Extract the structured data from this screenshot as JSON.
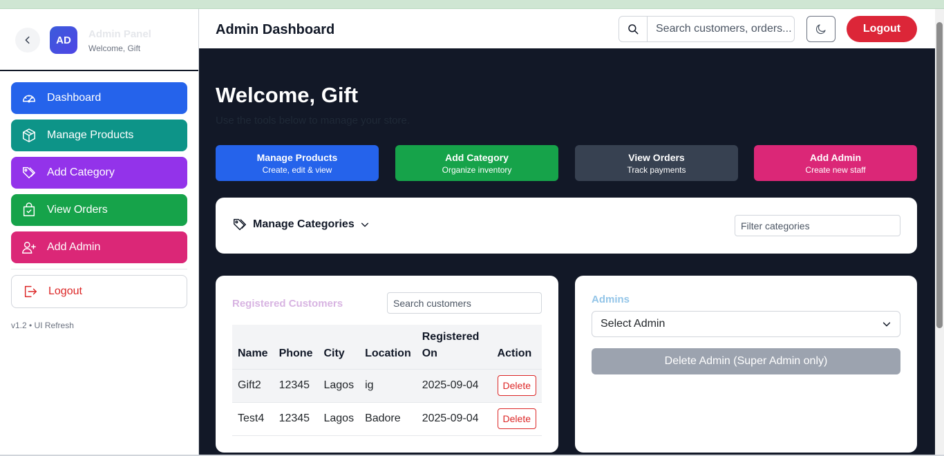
{
  "sidebar": {
    "avatar_initials": "AD",
    "panel_title": "Admin Panel",
    "panel_subtitle": "Welcome, Gift",
    "nav": [
      {
        "label": "Dashboard",
        "icon": "gauge-icon",
        "color": "#2563eb"
      },
      {
        "label": "Manage Products",
        "icon": "box-icon",
        "color": "#0d9488"
      },
      {
        "label": "Add Category",
        "icon": "tag-icon",
        "color": "#9333ea"
      },
      {
        "label": "View Orders",
        "icon": "bag-icon",
        "color": "#16a34a"
      },
      {
        "label": "Add Admin",
        "icon": "user-plus-icon",
        "color": "#db2777"
      }
    ],
    "logout_label": "Logout",
    "version": "v1.2 • UI Refresh"
  },
  "header": {
    "title": "Admin Dashboard",
    "search_placeholder": "Search customers, orders...",
    "logout_label": "Logout"
  },
  "main": {
    "welcome": "Welcome, Gift",
    "welcome_sub": "Use the tools below to manage your store.",
    "quick_actions": [
      {
        "title": "Manage Products",
        "subtitle": "Create, edit & view",
        "color": "#2563eb"
      },
      {
        "title": "Add Category",
        "subtitle": "Organize inventory",
        "color": "#16a34a"
      },
      {
        "title": "View Orders",
        "subtitle": "Track payments",
        "color": "#374151"
      },
      {
        "title": "Add Admin",
        "subtitle": "Create new staff",
        "color": "#db2777"
      }
    ],
    "categories": {
      "title": "Manage Categories",
      "filter_placeholder": "Filter categories"
    },
    "customers": {
      "title": "Registered Customers",
      "search_placeholder": "Search customers",
      "columns": [
        "Name",
        "Phone",
        "City",
        "Location",
        "Registered On",
        "Action"
      ],
      "rows": [
        {
          "name": "Gift2",
          "phone": "12345",
          "city": "Lagos",
          "location": "ig",
          "registered": "2025-09-04",
          "action": "Delete"
        },
        {
          "name": "Test4",
          "phone": "12345",
          "city": "Lagos",
          "location": "Badore",
          "registered": "2025-09-04",
          "action": "Delete"
        }
      ]
    },
    "admins": {
      "title": "Admins",
      "select_value": "Select Admin",
      "delete_label": "Delete Admin (Super Admin only)"
    }
  }
}
